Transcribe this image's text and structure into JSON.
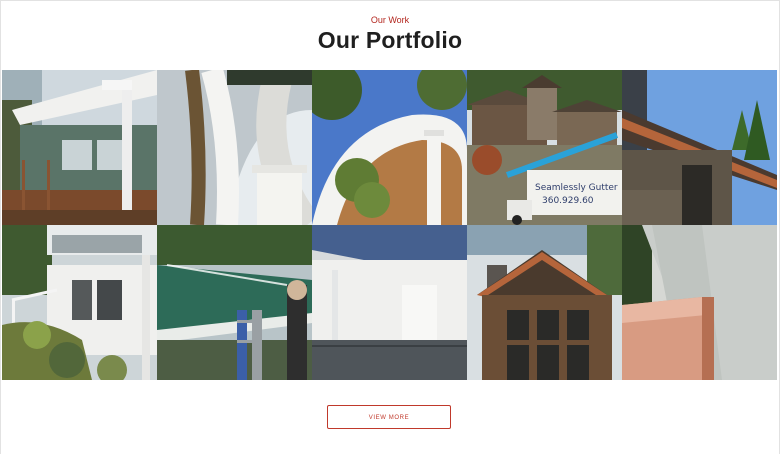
{
  "section": {
    "eyebrow": "Our Work",
    "title": "Our Portfolio"
  },
  "gallery": {
    "tiles": [
      "porch-gutter-photo",
      "gutter-closeup-photo",
      "round-porch-ceiling-photo",
      "house-lift-truck-photo",
      "copper-roof-stone-chimney-photo",
      "hillside-house-photo",
      "gutter-cleaning-photo",
      "metal-roof-downspout-photo",
      "wood-lodge-house-photo",
      "copper-gutter-closeup-photo"
    ],
    "truck_text": [
      "Seamlessly Gutter",
      "360.929.60"
    ]
  },
  "actions": {
    "view_more_label": "VIEW MORE"
  },
  "colors": {
    "accent": "#b3261e",
    "title": "#1f1f1f"
  }
}
